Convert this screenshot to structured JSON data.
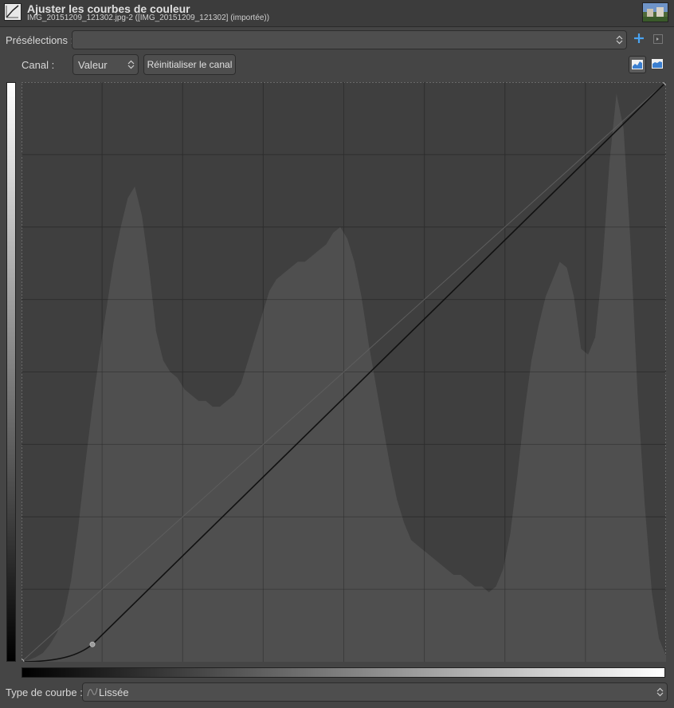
{
  "header": {
    "title": "Ajuster les courbes de couleur",
    "subtitle": "IMG_20151209_121302.jpg-2 ([IMG_20151209_121302] (importée))"
  },
  "presets": {
    "label": "Présélections :",
    "value": ""
  },
  "channel": {
    "label": "Canal :",
    "value": "Valeur",
    "reset_label": "Réinitialiser le canal"
  },
  "curve_type": {
    "label": "Type de courbe :",
    "value": "Lissée"
  },
  "curve": {
    "type": "smooth",
    "points": [
      [
        0,
        0
      ],
      [
        0.11,
        0.03
      ],
      [
        1,
        1
      ]
    ]
  },
  "histogram": {
    "samples": [
      0,
      0.003,
      0.008,
      0.015,
      0.03,
      0.05,
      0.08,
      0.14,
      0.23,
      0.34,
      0.44,
      0.53,
      0.61,
      0.69,
      0.75,
      0.8,
      0.82,
      0.77,
      0.68,
      0.57,
      0.52,
      0.5,
      0.49,
      0.47,
      0.46,
      0.45,
      0.45,
      0.44,
      0.44,
      0.45,
      0.46,
      0.48,
      0.52,
      0.56,
      0.6,
      0.64,
      0.66,
      0.67,
      0.68,
      0.69,
      0.69,
      0.7,
      0.71,
      0.72,
      0.74,
      0.75,
      0.73,
      0.69,
      0.63,
      0.55,
      0.48,
      0.41,
      0.34,
      0.28,
      0.24,
      0.21,
      0.2,
      0.19,
      0.18,
      0.17,
      0.16,
      0.15,
      0.15,
      0.14,
      0.13,
      0.13,
      0.12,
      0.13,
      0.16,
      0.22,
      0.32,
      0.43,
      0.52,
      0.58,
      0.63,
      0.66,
      0.69,
      0.68,
      0.63,
      0.54,
      0.53,
      0.56,
      0.68,
      0.86,
      0.98,
      0.92,
      0.72,
      0.46,
      0.27,
      0.12,
      0.04,
      0.01
    ],
    "color": "#4f4f4f"
  },
  "colors": {
    "background": "#454545",
    "graph_bg": "#3f3f3f",
    "grid": "#2e2e2e",
    "curve": "#111111",
    "accent": "#4aa3f0"
  }
}
